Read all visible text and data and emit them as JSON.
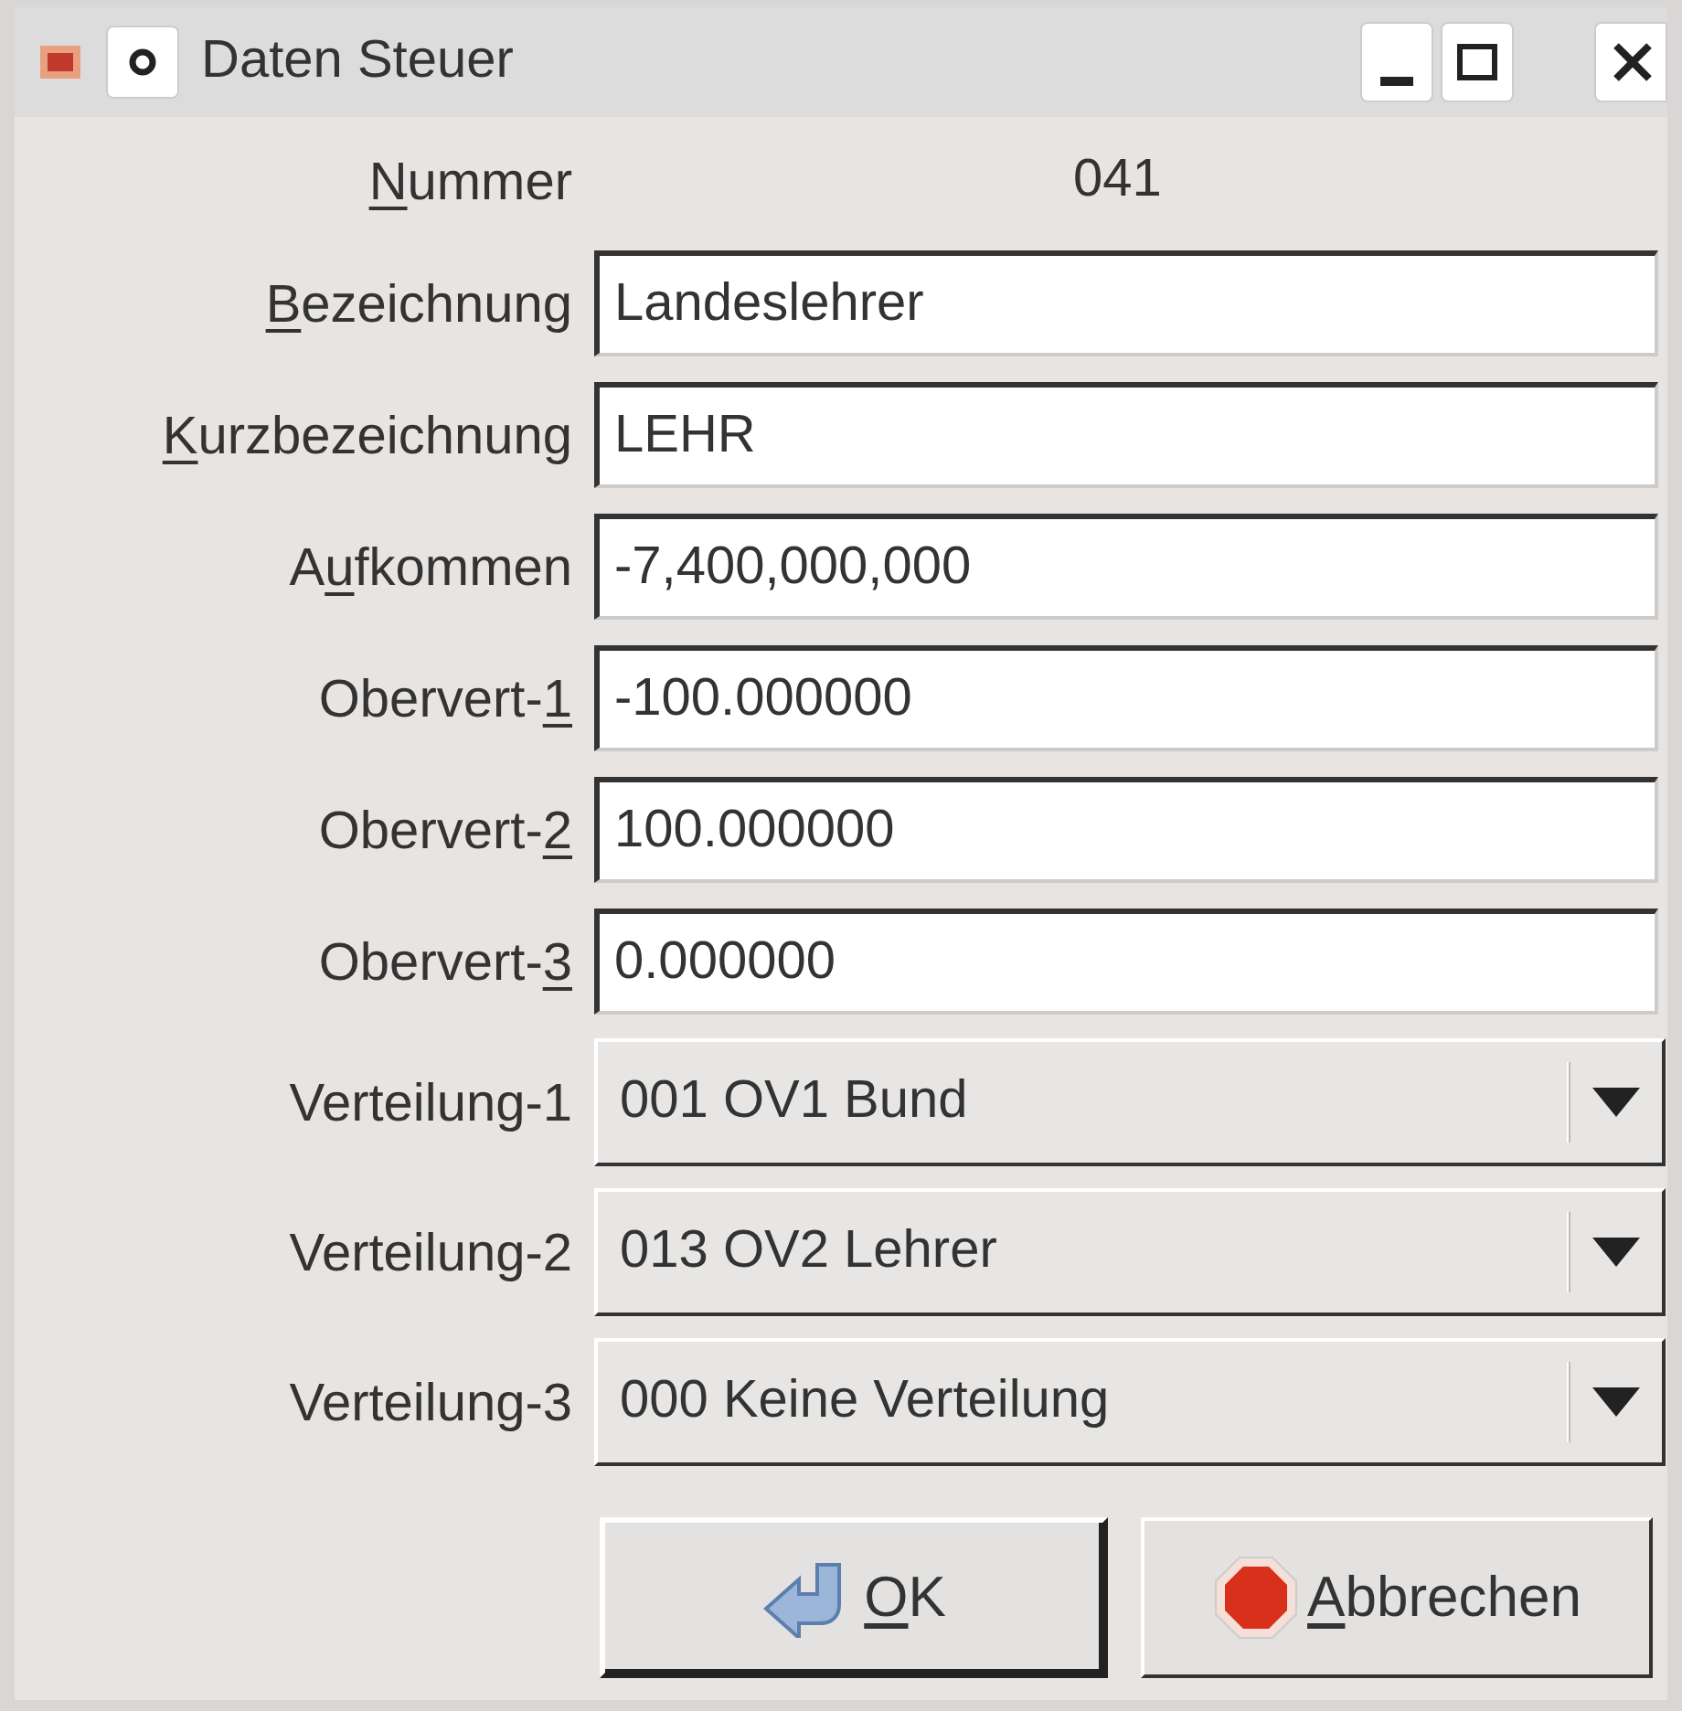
{
  "window": {
    "title": "Daten Steuer"
  },
  "fields": [
    {
      "kind": "display",
      "label": {
        "key": "N",
        "after": "ummer"
      },
      "value": "041"
    },
    {
      "kind": "input",
      "label": {
        "key": "B",
        "after": "ezeichnung"
      },
      "value": "Landeslehrer"
    },
    {
      "kind": "input",
      "label": {
        "key": "K",
        "after": "urzbezeichnung"
      },
      "value": "LEHR"
    },
    {
      "kind": "input",
      "label": {
        "before": "A",
        "key": "u",
        "after": "fkommen"
      },
      "value": "-7,400,000,000"
    },
    {
      "kind": "input",
      "label": {
        "before": "Obervert-",
        "key": "1"
      },
      "value": "-100.000000"
    },
    {
      "kind": "input",
      "label": {
        "before": "Obervert-",
        "key": "2"
      },
      "value": "100.000000"
    },
    {
      "kind": "input",
      "label": {
        "before": "Obervert-",
        "key": "3"
      },
      "value": "0.000000"
    },
    {
      "kind": "combo",
      "label": {
        "before": "Verteilung-1"
      },
      "value": "001 OV1 Bund"
    },
    {
      "kind": "combo",
      "label": {
        "before": "Verteilung-2"
      },
      "value": "013 OV2 Lehrer"
    },
    {
      "kind": "combo",
      "label": {
        "before": "Verteilung-3"
      },
      "value": "000 Keine Verteilung"
    }
  ],
  "buttons": [
    {
      "kind": "ok",
      "label": {
        "key": "O",
        "after": "K"
      },
      "default": true
    },
    {
      "kind": "cancel",
      "label": {
        "key": "A",
        "after": "bbrechen"
      },
      "default": false
    }
  ]
}
